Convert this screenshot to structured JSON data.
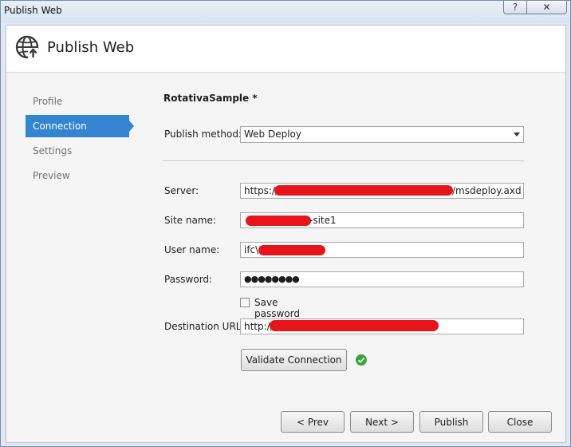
{
  "window": {
    "title": "Publish Web",
    "help_glyph": "?",
    "close_glyph": "✕"
  },
  "header": {
    "title": "Publish Web",
    "icon": "globe-publish-icon"
  },
  "nav": {
    "items": [
      {
        "label": "Profile",
        "active": false
      },
      {
        "label": "Connection",
        "active": true
      },
      {
        "label": "Settings",
        "active": false
      },
      {
        "label": "Preview",
        "active": false
      }
    ]
  },
  "form": {
    "profile_name": "RotativaSample *",
    "publish_method": {
      "label": "Publish method:",
      "value": "Web Deploy"
    },
    "server": {
      "label": "Server:",
      "prefix": "https://",
      "suffix": "/msdeploy.axd"
    },
    "site_name": {
      "label": "Site name:",
      "suffix": "-site1"
    },
    "user_name": {
      "label": "User name:",
      "prefix": "ifc\\"
    },
    "password": {
      "label": "Password:",
      "value": "●●●●●●●●"
    },
    "save_password": {
      "label": "Save password",
      "checked": false
    },
    "destination_url": {
      "label": "Destination URL:",
      "prefix": "http://"
    },
    "validate_button": "Validate Connection"
  },
  "footer": {
    "prev": "< Prev",
    "next": "Next >",
    "publish": "Publish",
    "close": "Close"
  },
  "colors": {
    "accent": "#3485d1",
    "redaction": "#e8141b",
    "success": "#3aa53a"
  }
}
